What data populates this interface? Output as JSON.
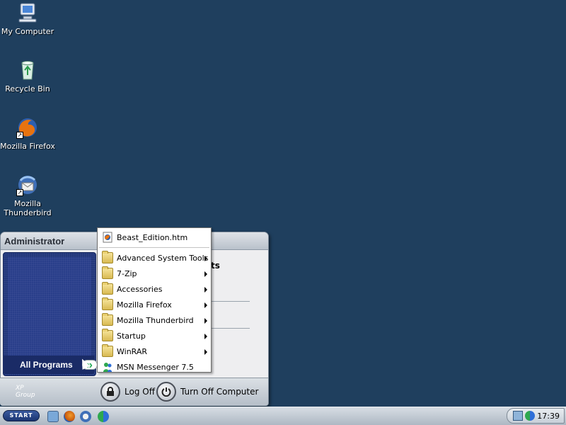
{
  "desktop": {
    "icons": [
      {
        "label": "My Computer",
        "icon": "my-computer-icon"
      },
      {
        "label": "Recycle Bin",
        "icon": "recycle-bin-icon"
      },
      {
        "label": "Mozilla Firefox",
        "icon": "firefox-icon"
      },
      {
        "label": "Mozilla\nThunderbird",
        "icon": "thunderbird-icon"
      }
    ],
    "background_color": "#1f3f5e"
  },
  "start_menu": {
    "user": "Administrator",
    "all_programs": "All Programs",
    "right_partial_text": "ts",
    "footer": {
      "logo_text": "XP\nGroup",
      "log_off": "Log Off",
      "turn_off": "Turn Off Computer"
    }
  },
  "programs_menu": {
    "top_item": "Beast_Edition.htm",
    "items": [
      {
        "label": "Advanced System Tools",
        "has_submenu": true
      },
      {
        "label": "7-Zip",
        "has_submenu": true
      },
      {
        "label": "Accessories",
        "has_submenu": true
      },
      {
        "label": "Mozilla Firefox",
        "has_submenu": true
      },
      {
        "label": "Mozilla Thunderbird",
        "has_submenu": true
      },
      {
        "label": "Startup",
        "has_submenu": true
      },
      {
        "label": "WinRAR",
        "has_submenu": true
      },
      {
        "label": "MSN Messenger 7.5",
        "has_submenu": false
      }
    ]
  },
  "taskbar": {
    "start_label": "START",
    "clock": "17:39"
  }
}
